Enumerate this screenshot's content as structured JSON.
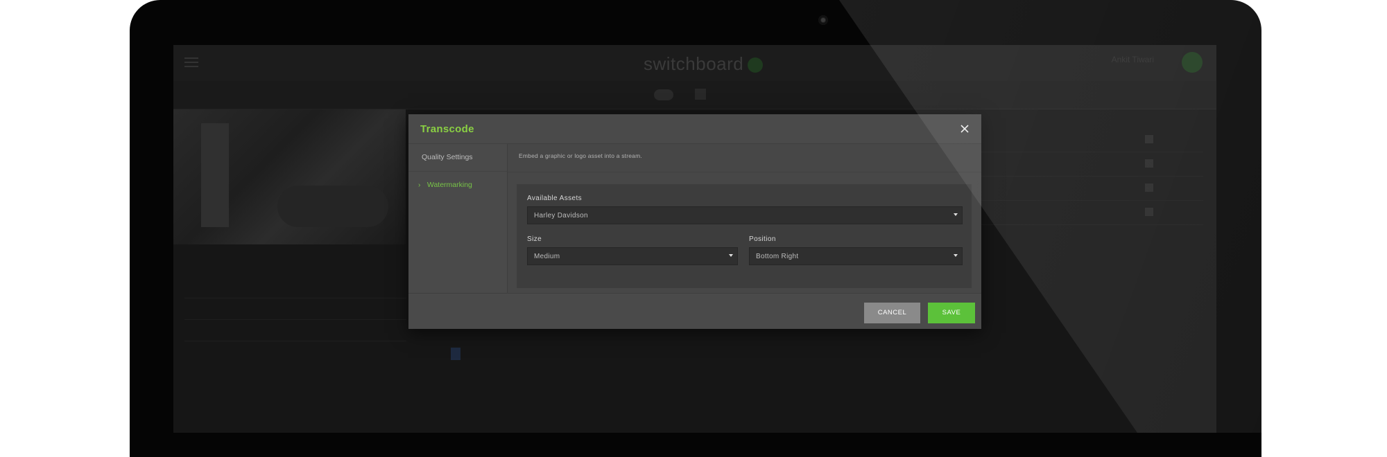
{
  "app": {
    "logo_text": "switchboard",
    "user_name": "Ankit Tiwari"
  },
  "modal": {
    "title": "Transcode",
    "nav": [
      {
        "label": "Quality Settings",
        "active": false
      },
      {
        "label": "Watermarking",
        "active": true
      }
    ],
    "description": "Embed a graphic or logo asset into a stream.",
    "fields": {
      "assets": {
        "label": "Available Assets",
        "value": "Harley Davidson"
      },
      "size": {
        "label": "Size",
        "value": "Medium"
      },
      "position": {
        "label": "Position",
        "value": "Bottom Right"
      }
    },
    "buttons": {
      "cancel": "CANCEL",
      "save": "SAVE"
    }
  },
  "colors": {
    "accent": "#8ad043",
    "save_button": "#5cc13a",
    "cancel_button": "#8a8a8a",
    "modal_bg": "#4a4a4a"
  },
  "icons": {
    "close": "close-icon",
    "chevron": "chevron-right-icon",
    "caret": "caret-down-icon",
    "menu": "hamburger-menu-icon"
  }
}
